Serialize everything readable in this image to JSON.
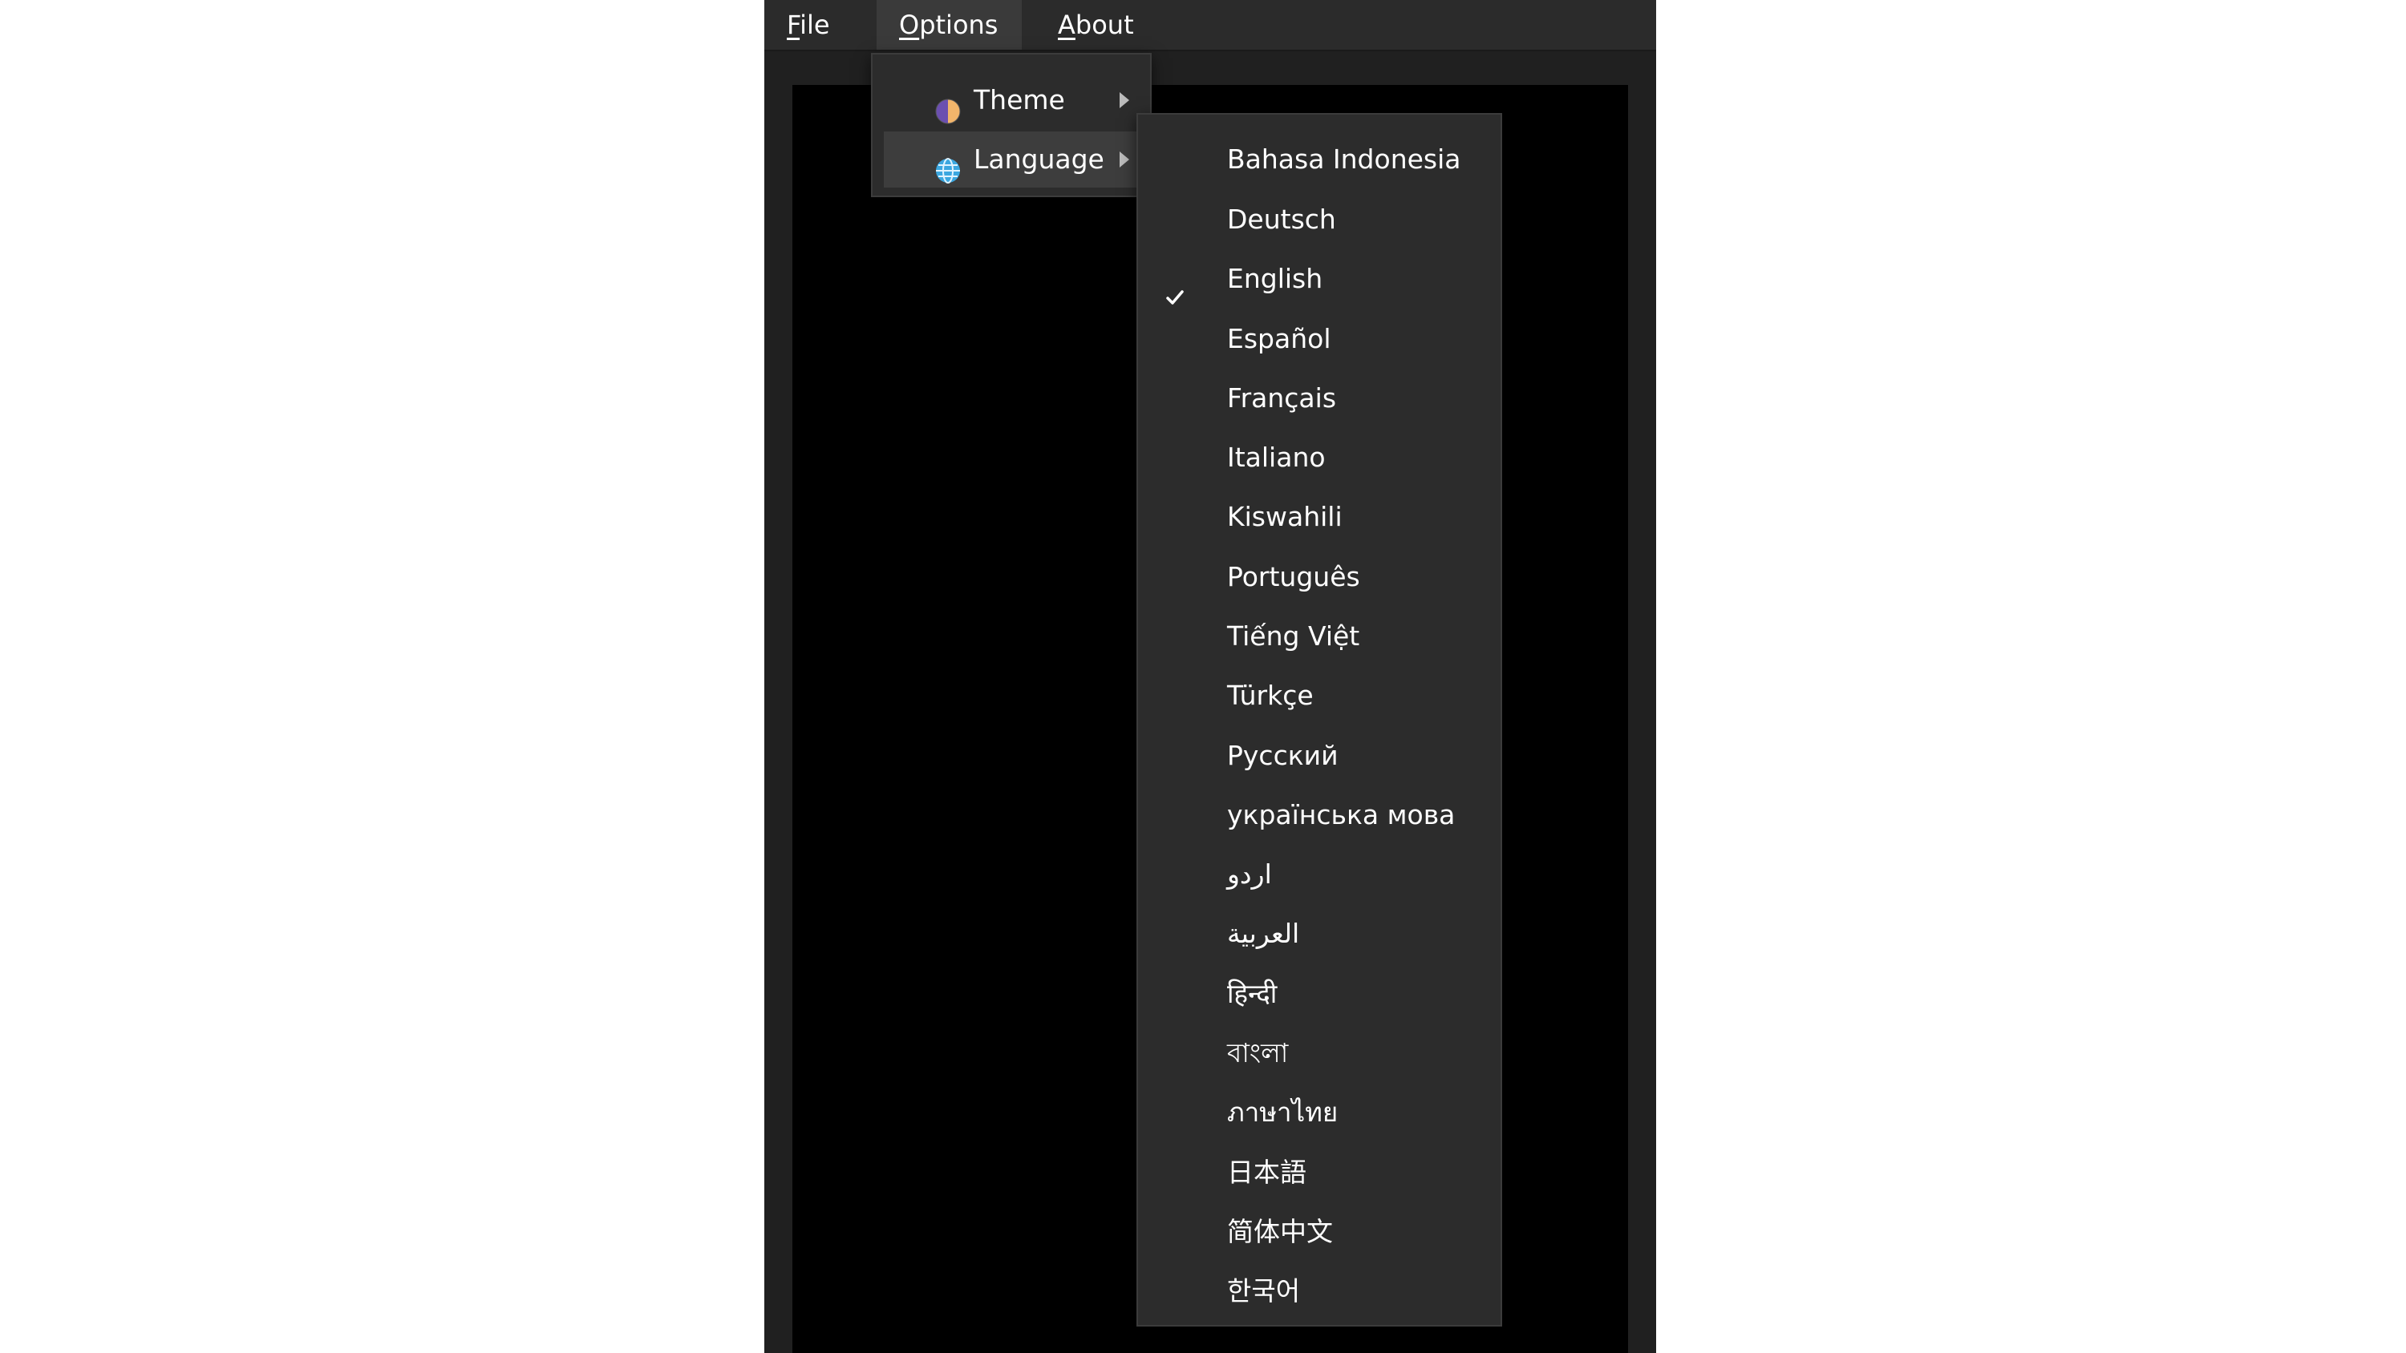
{
  "menubar": {
    "items": [
      {
        "label": "File",
        "mnemonic": "F",
        "rest": "ile"
      },
      {
        "label": "Options",
        "mnemonic": "O",
        "rest": "ptions"
      },
      {
        "label": "About",
        "mnemonic": "A",
        "rest": "bout"
      }
    ],
    "active": "Options"
  },
  "options_menu": {
    "items": [
      {
        "label": "Theme",
        "icon": "theme-icon",
        "submenu": true
      },
      {
        "label": "Language",
        "icon": "globe-icon",
        "submenu": true,
        "highlighted": true
      }
    ]
  },
  "language_menu": {
    "selected": "English",
    "items": [
      "Bahasa Indonesia",
      "Deutsch",
      "English",
      "Español",
      "Français",
      "Italiano",
      "Kiswahili",
      "Português",
      "Tiếng Việt",
      "Türkçe",
      "Русский",
      "українська мова",
      "اردو",
      "العربية",
      "हिन्दी",
      "বাংলা",
      "ภาษาไทย",
      "日本語",
      "简体中文",
      "한국어"
    ]
  },
  "colors": {
    "menubar_bg": "#2b2b2b",
    "menu_bg": "#2c2c2c",
    "highlight_bg": "#3d3d3d",
    "canvas_bg": "#000000",
    "text": "#ffffff"
  }
}
